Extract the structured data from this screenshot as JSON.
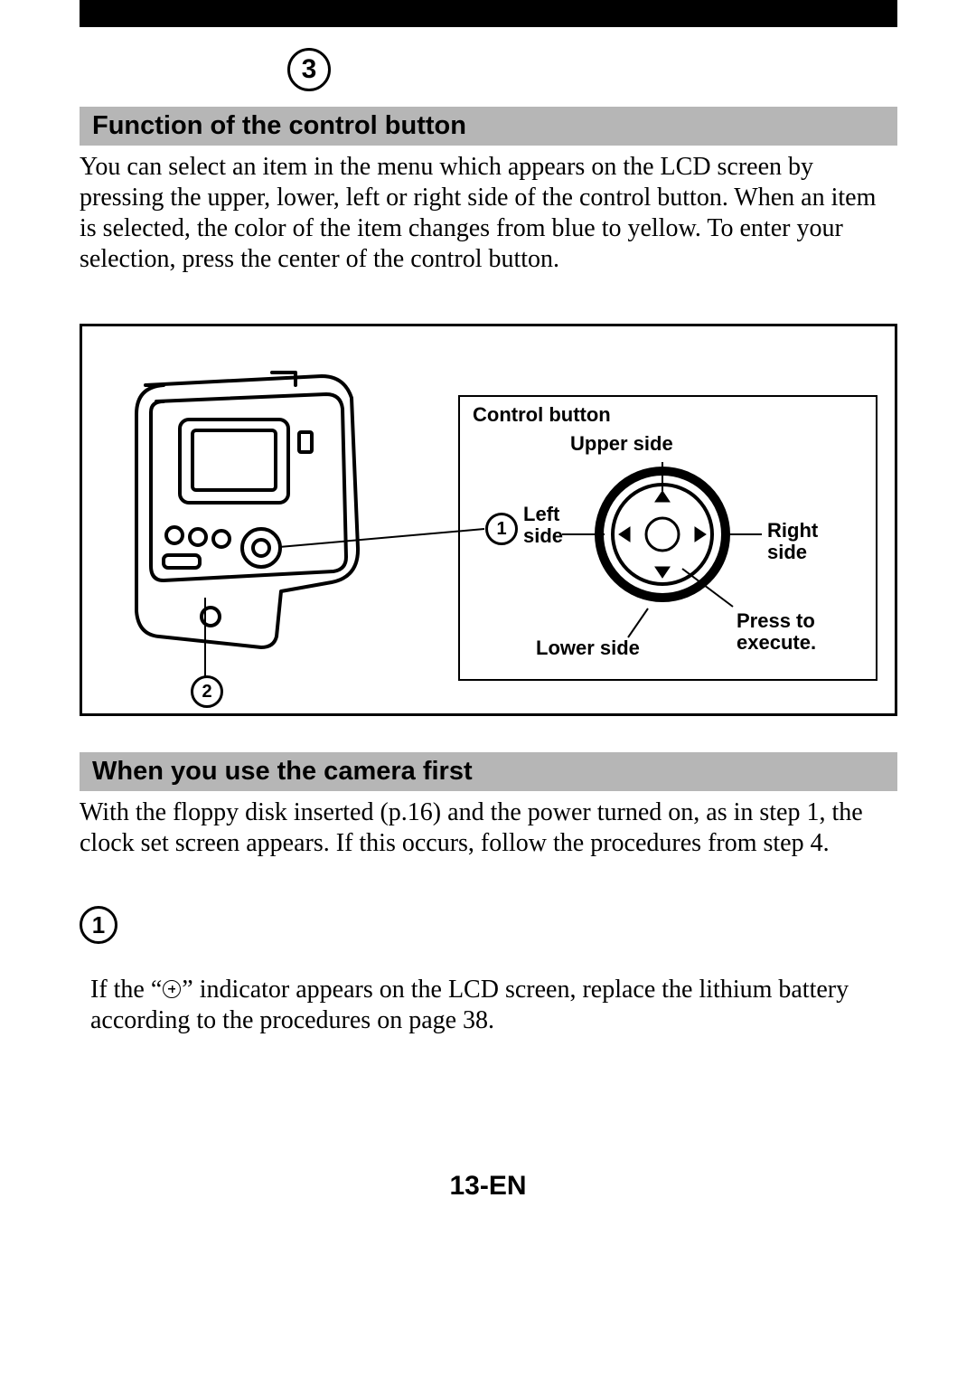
{
  "top_step_number": "3",
  "section1": {
    "title": "Function of the control button",
    "text": "You can select an item in the menu which appears on the LCD screen by pressing the upper, lower, left or right side of the control button. When an item is selected, the color of the item changes from blue to yellow. To enter your selection, press the center of the control button."
  },
  "figure": {
    "callout_1": "1",
    "callout_2": "2",
    "labels": {
      "title": "Control button",
      "upper": "Upper side",
      "left": "Left side",
      "right": "Right side",
      "lower": "Lower side",
      "press": "Press to execute."
    }
  },
  "section2": {
    "title": "When you use the camera first",
    "text": "With the floppy disk inserted (p.16) and the power turned on, as in step 1, the clock set screen appears. If this occurs, follow the procedures from step 4."
  },
  "step1": {
    "num": "1",
    "before": "If the “",
    "after": "” indicator appears on the LCD screen, replace the lithium battery according to the procedures on page 38."
  },
  "page_number": "13-EN"
}
